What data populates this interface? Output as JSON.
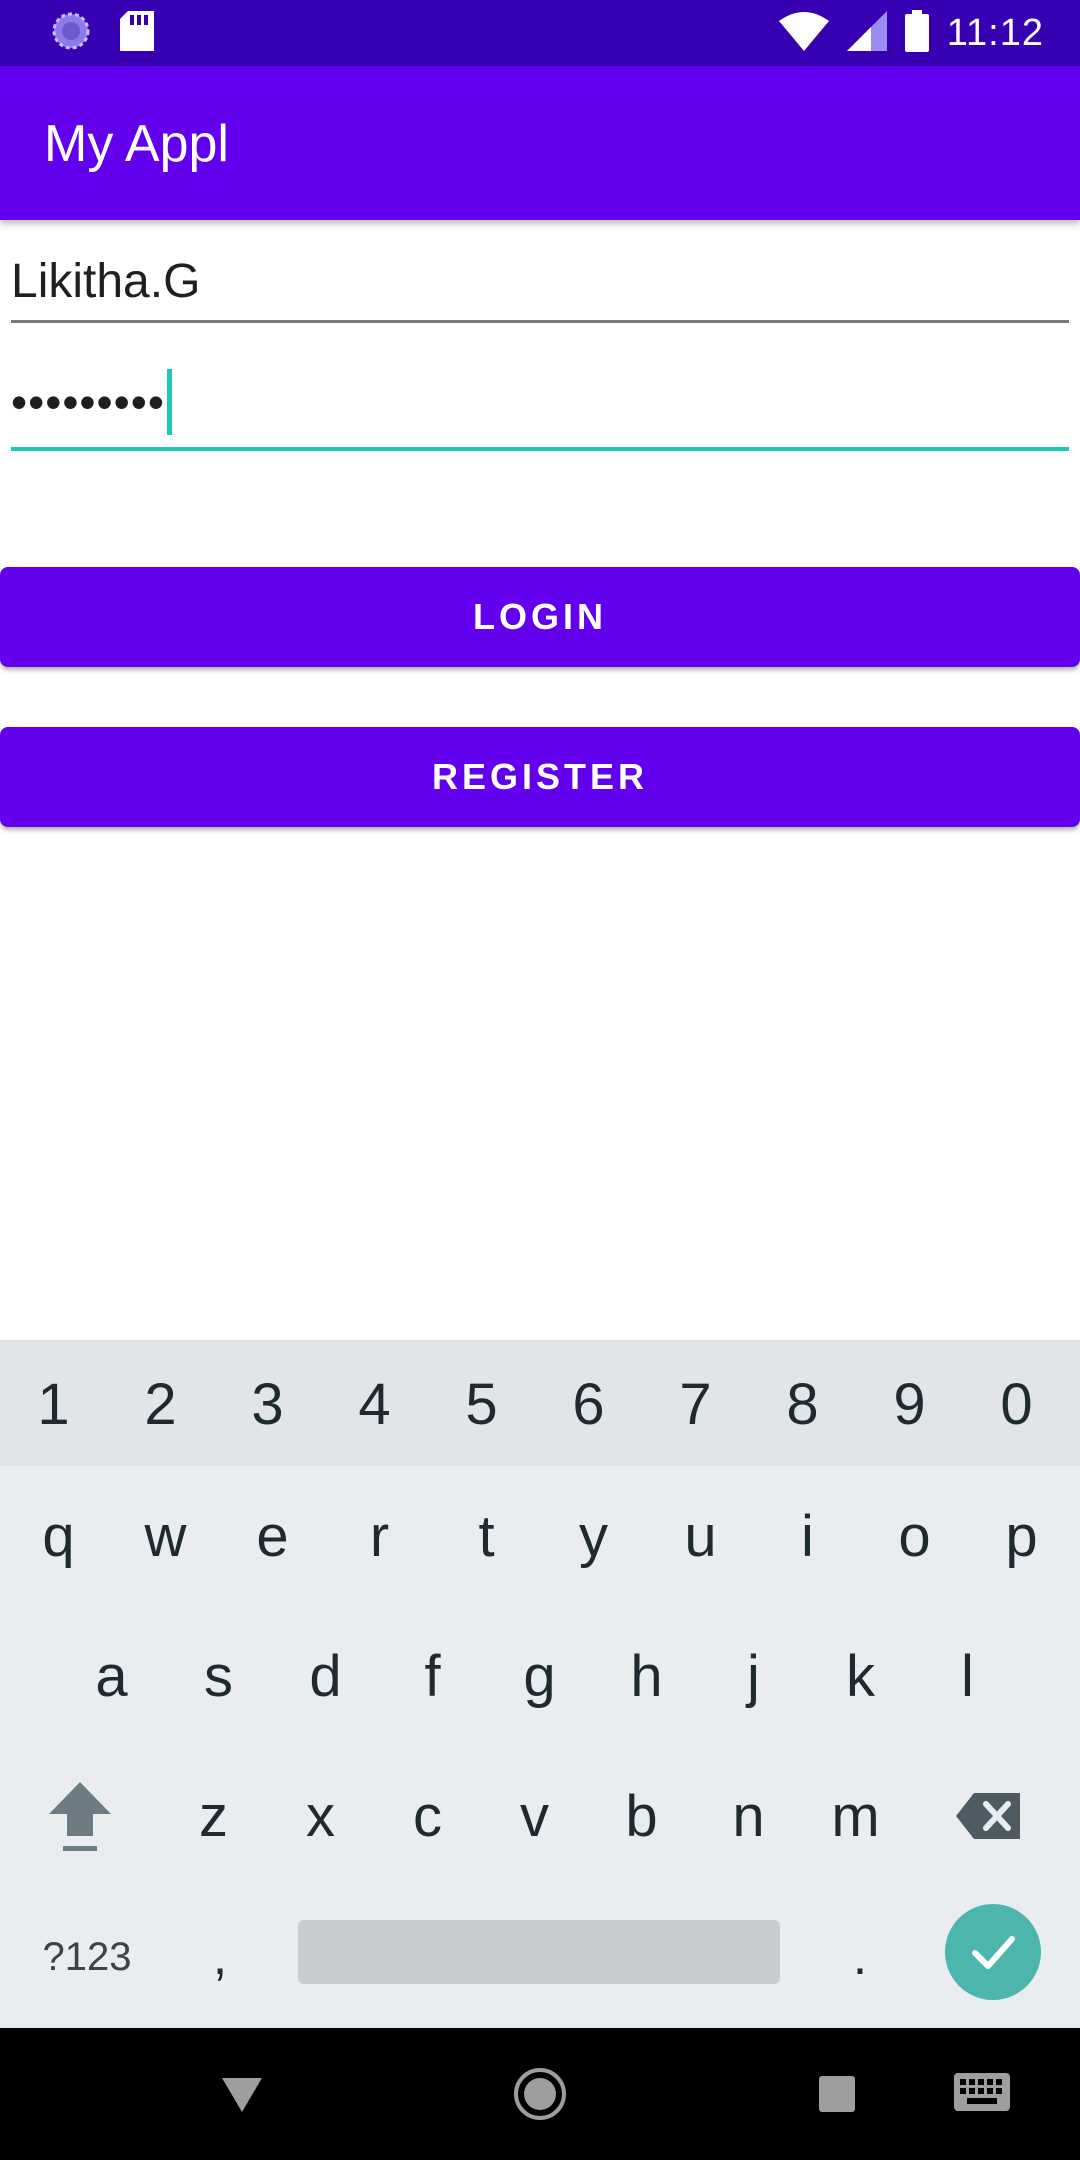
{
  "status_bar": {
    "time": "11:12",
    "icons": [
      "sync-icon",
      "sd-card-icon",
      "wifi-icon",
      "signal-icon",
      "battery-icon"
    ]
  },
  "app_bar": {
    "title": "My Appl"
  },
  "form": {
    "username_value": "Likitha.G",
    "password_value": "•••••••••"
  },
  "buttons": {
    "login": "LOGIN",
    "register": "REGISTER"
  },
  "keyboard": {
    "numbers": [
      "1",
      "2",
      "3",
      "4",
      "5",
      "6",
      "7",
      "8",
      "9",
      "0"
    ],
    "row1": [
      "q",
      "w",
      "e",
      "r",
      "t",
      "y",
      "u",
      "i",
      "o",
      "p"
    ],
    "row2": [
      "a",
      "s",
      "d",
      "f",
      "g",
      "h",
      "j",
      "k",
      "l"
    ],
    "row3": [
      "z",
      "x",
      "c",
      "v",
      "b",
      "n",
      "m"
    ],
    "symbols_label": "?123",
    "comma": ",",
    "period": "."
  },
  "colors": {
    "status_bar": "#3700b3",
    "primary": "#6200ee",
    "accent": "#1bc9b6",
    "enter_key": "#4db6ac"
  },
  "nav_bar": {
    "icons": [
      "back-icon",
      "home-icon",
      "recents-icon",
      "keyboard-switch-icon"
    ]
  }
}
